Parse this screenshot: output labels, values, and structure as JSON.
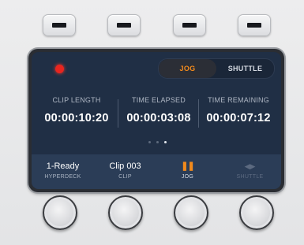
{
  "screen": {
    "toggle": {
      "jog_label": "JOG",
      "shuttle_label": "SHUTTLE",
      "selected": "JOG"
    },
    "timecodes": [
      {
        "label": "CLIP LENGTH",
        "value": "00:00:10:20"
      },
      {
        "label": "TIME ELAPSED",
        "value": "00:00:03:08"
      },
      {
        "label": "TIME REMAINING",
        "value": "00:00:07:12"
      }
    ],
    "page_indicator": {
      "count": 3,
      "active": 3
    },
    "bottom": {
      "deck": {
        "main": "1-Ready",
        "sub": "HYPERDECK"
      },
      "clip": {
        "main": "Clip 003",
        "sub": "CLIP"
      },
      "jog": {
        "icon": "pause-icon",
        "sub": "JOG"
      },
      "shuttle": {
        "icon": "shuttle-arrows-icon",
        "sub": "SHUTTLE",
        "enabled": false
      }
    }
  },
  "colors": {
    "accent": "#f28a1c",
    "record": "#e8251f",
    "screen_bg": "#202f45",
    "bottom_bar": "#2b3d57"
  }
}
